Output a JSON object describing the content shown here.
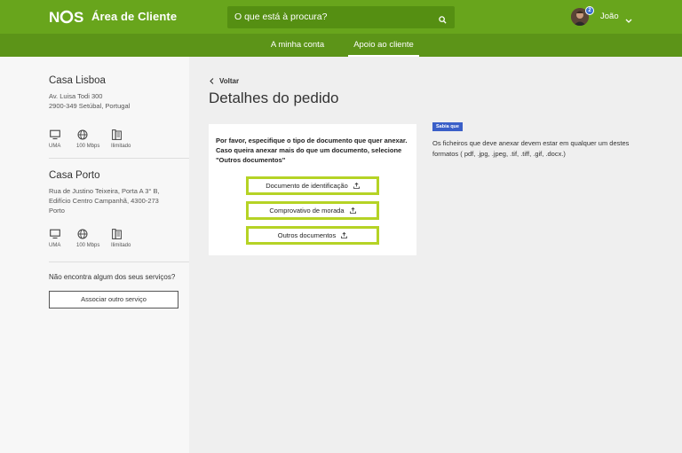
{
  "header": {
    "logo_text": "NOS",
    "area_title": "Área de Cliente",
    "search_placeholder": "O que está à procura?",
    "user_name": "João",
    "notification_count": "2"
  },
  "nav": {
    "tabs": [
      {
        "label": "A minha conta",
        "active": false
      },
      {
        "label": "Apoio ao cliente",
        "active": true
      }
    ]
  },
  "sidebar": {
    "houses": [
      {
        "name": "Casa Lisboa",
        "address": [
          "Av. Luisa Todi 300",
          "2900-349 Setúbal, Portugal"
        ],
        "services": [
          "UMA",
          "100 Mbps",
          "Ilimitado"
        ]
      },
      {
        "name": "Casa Porto",
        "address": [
          "Rua de Justino Teixeira, Porta A 3° B,",
          "Edifício Centro Campanhã, 4300-273",
          "Porto"
        ],
        "services": [
          "UMA",
          "100 Mbps",
          "Ilimitado"
        ]
      }
    ],
    "missing_text": "Não encontra algum dos seus serviços?",
    "associate_button": "Associar outro serviço"
  },
  "main": {
    "back_label": "Voltar",
    "title": "Detalhes do pedido",
    "instructions": "Por favor, especifique o tipo de documento que quer anexar. Caso queira anexar mais do que um documento, selecione \"Outros documentos\"",
    "buttons": [
      "Documento de identificação",
      "Comprovativo de morada",
      "Outros documentos"
    ]
  },
  "tip": {
    "badge": "Sabia que",
    "text": "Os ficheiros que deve anexar devem estar em qualquer um destes formatos ( pdf, .jpg, .jpeg, .tif, .tiff, .gif, .docx.)"
  },
  "colors": {
    "brand_green": "#68a51c",
    "subnav_green": "#5c9418",
    "button_border": "#b5d325",
    "badge_blue": "#3a5fc8"
  }
}
